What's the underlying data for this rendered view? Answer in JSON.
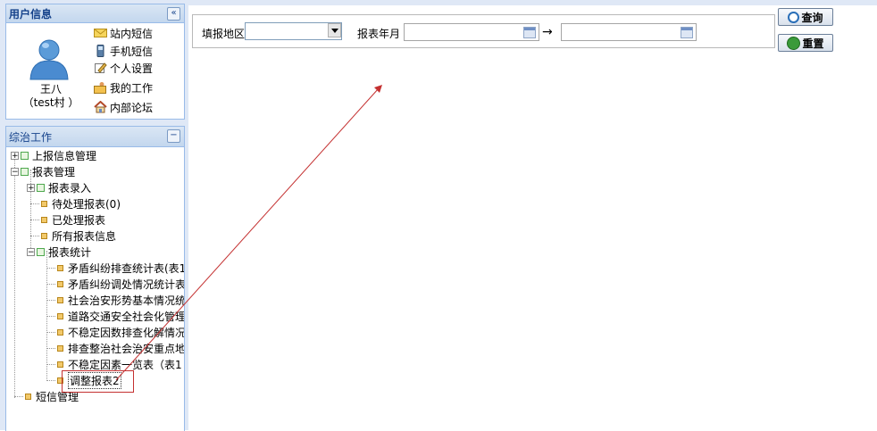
{
  "user_panel": {
    "title": "用户信息",
    "collapse_glyph": "«",
    "user_name": "王八",
    "user_village": "（test村 ）",
    "links": [
      {
        "label": "站内短信",
        "icon": "mail-icon"
      },
      {
        "label": "手机短信",
        "icon": "phone-icon"
      },
      {
        "label": "个人设置",
        "icon": "edit-icon"
      },
      {
        "label": "我的工作",
        "icon": "work-icon"
      },
      {
        "label": "内部论坛",
        "icon": "home-icon"
      }
    ]
  },
  "nav_panel": {
    "title": "综治工作",
    "collapse_glyph": "−",
    "tree": [
      {
        "label": "上报信息管理"
      },
      {
        "label": "报表管理"
      },
      {
        "label": "报表录入"
      },
      {
        "label": "待处理报表(0)"
      },
      {
        "label": "已处理报表"
      },
      {
        "label": "所有报表信息"
      },
      {
        "label": "报表统计"
      },
      {
        "label": "矛盾纠纷排查统计表(表1"
      },
      {
        "label": "矛盾纠纷调处情况统计表"
      },
      {
        "label": "社会治安形势基本情况统"
      },
      {
        "label": "道路交通安全社会化管理"
      },
      {
        "label": "不稳定因数排查化解情况"
      },
      {
        "label": "排查整治社会治安重点地"
      },
      {
        "label": "不稳定因素一览表（表1"
      },
      {
        "label": "调整报表2"
      },
      {
        "label": "短信管理"
      }
    ]
  },
  "filter": {
    "region_label": "填报地区",
    "region_value": "",
    "month_label": "报表年月",
    "start_value": "",
    "end_value": "",
    "range_arrow": "→"
  },
  "buttons": {
    "query": "查询",
    "reset": "重置"
  },
  "colors": {
    "panel_border": "#99bbe8",
    "header_text": "#15428b",
    "annotation_red": "#c43030"
  }
}
